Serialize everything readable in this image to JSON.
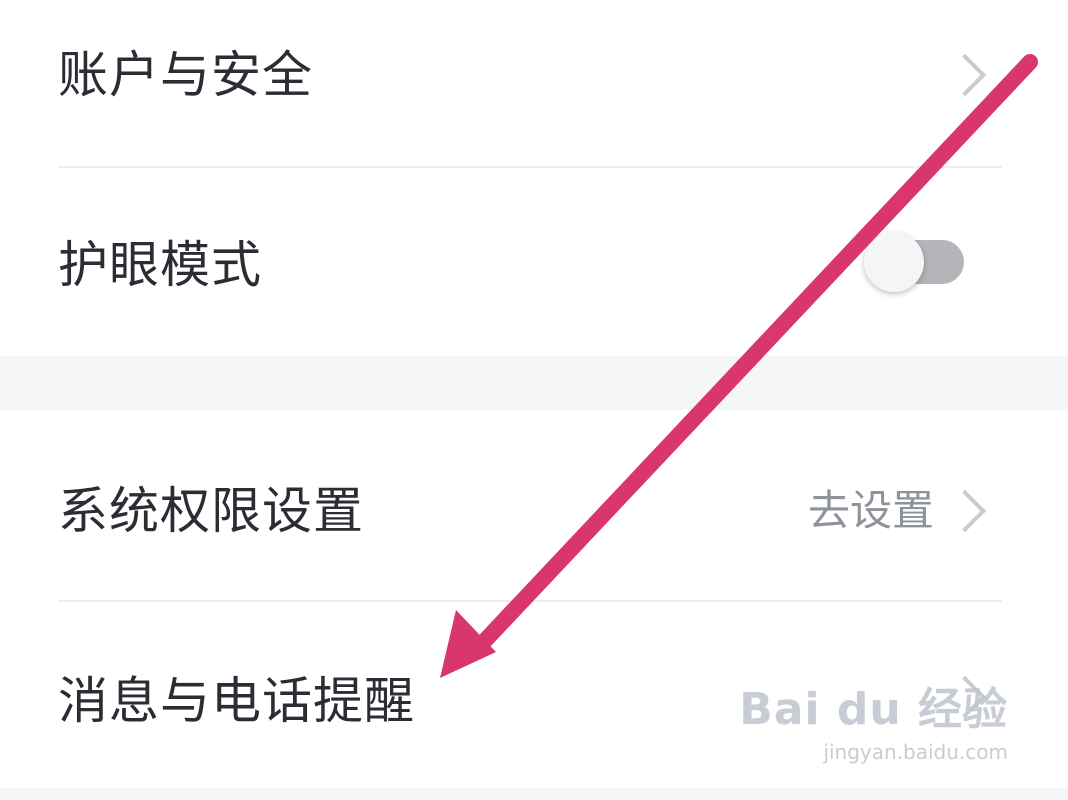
{
  "settings": {
    "items": [
      {
        "label": "账户与安全"
      },
      {
        "label": "护眼模式",
        "toggle_on": false
      },
      {
        "label": "系统权限设置",
        "hint": "去设置"
      },
      {
        "label": "消息与电话提醒"
      }
    ]
  },
  "annotation": {
    "arrow_color": "#d9366f"
  },
  "watermark": {
    "logo": "Bai du 经验",
    "url": "jingyan.baidu.com"
  }
}
